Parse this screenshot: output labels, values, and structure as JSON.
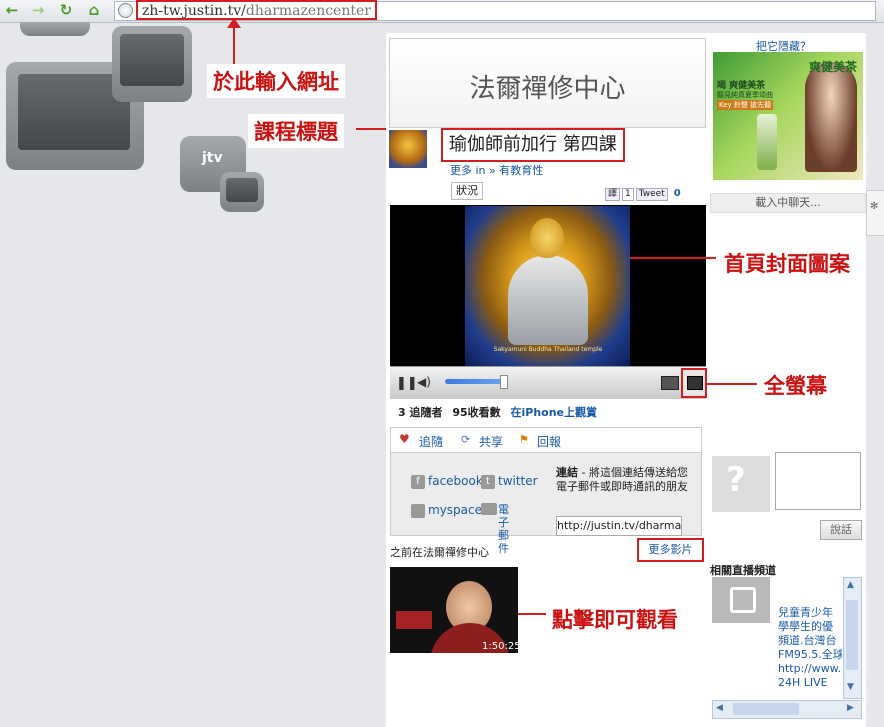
{
  "browser": {
    "url_domain": "zh-tw.justin.tv/",
    "url_path": "dharmazencenter"
  },
  "annotations": {
    "enter_url": "於此輸入網址",
    "course_title": "課程標題",
    "home_cover": "首頁封面圖案",
    "fullscreen": "全螢幕",
    "click_to_watch": "點擊即可觀看"
  },
  "channel": {
    "title": "法爾禪修中心",
    "lesson_title": "瑜伽師前加行 第四課",
    "more_in_prefix": "更多 in »",
    "category": "有教育性",
    "status_tab": "狀況",
    "share_count": "1",
    "tweet_count": "0",
    "share_label": "譯",
    "tweet_label": "Tweet"
  },
  "video": {
    "caption": "Sakyamuni Buddha Thailand temple"
  },
  "stats": {
    "followers": "3 追隨者",
    "views": "95收看數",
    "iphone": "在iPhone上觀賞"
  },
  "actions": {
    "follow": "追隨",
    "share": "共享",
    "report": "回報"
  },
  "share": {
    "facebook": "facebook",
    "twitter": "twitter",
    "myspace": "myspace",
    "email": "電子郵件",
    "link_title": "連結",
    "link_desc": " - 將這個連結傳送給您電子郵件或即時通訊的朋友",
    "link_value": "http://justin.tv/dharmaz"
  },
  "previous": {
    "label": "之前在法爾禪修中心",
    "more": "更多影片",
    "thumb_time": "1:50:25"
  },
  "sidebar": {
    "hide": "把它隱藏？",
    "ad_brand": "爽健美茶",
    "ad_line1": "喝 爽健美茶",
    "ad_line2": "聽見純真夏季頌曲",
    "ad_line3": "Key 鈴聲 搶先聽",
    "chat_loading": "載入中聊天...",
    "send": "說話",
    "related_title": "相關直播頻道",
    "related_desc": [
      "兒童青少年",
      "學學生的優",
      "頻道.台灣台",
      "FM95.5.全球",
      "http://www.",
      "24H LIVE"
    ]
  },
  "colors": {
    "annotation": "#d21e1e",
    "link": "#1a5aa6"
  }
}
